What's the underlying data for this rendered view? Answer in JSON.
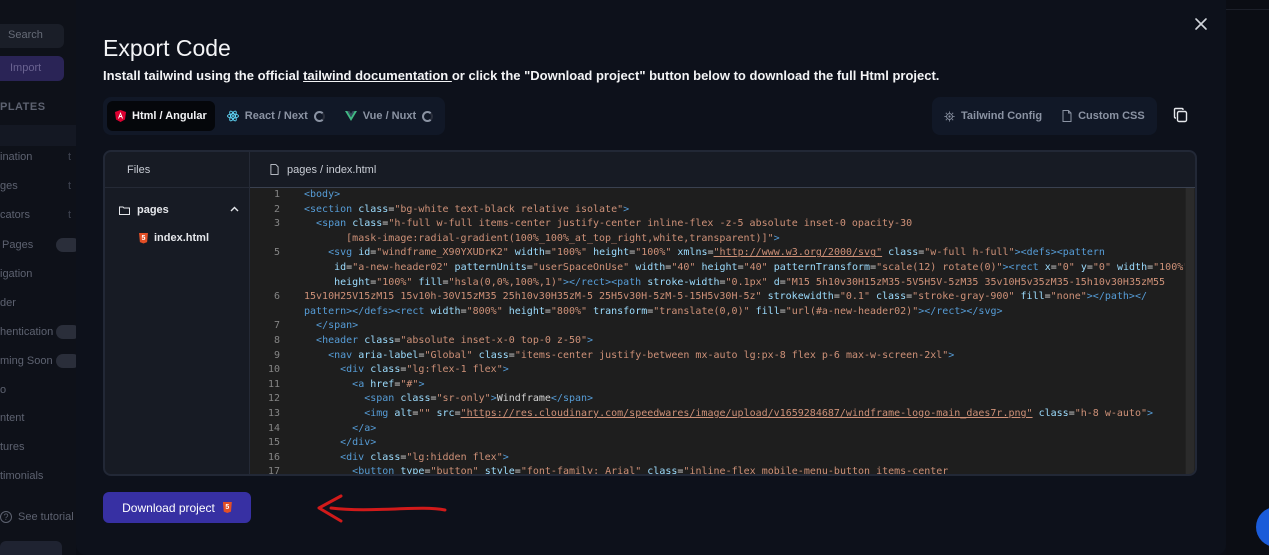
{
  "background": {
    "search_label": "Search",
    "import_label": "Import",
    "section_heading": "PLATES",
    "items": [
      {
        "label": "ination",
        "sub": "t"
      },
      {
        "label": "ges",
        "sub": "t"
      },
      {
        "label": "cators",
        "sub": "t"
      },
      {
        "label": "Pages",
        "badge": true
      },
      {
        "label": "igation"
      },
      {
        "label": "der"
      },
      {
        "label": "hentication",
        "badge": true
      },
      {
        "label": "ming Soon",
        "badge": true
      },
      {
        "label": "o"
      },
      {
        "label": "ntent"
      },
      {
        "label": "tures"
      },
      {
        "label": "timonials"
      }
    ],
    "tutorial_label": "See tutorial"
  },
  "modal": {
    "title": "Export Code",
    "subtitle_before": "Install tailwind using the official ",
    "subtitle_link": "tailwind documentation ",
    "subtitle_after": "or click the \"Download project\" button below to download the full Html project.",
    "frameworks": [
      {
        "label": "Html / Angular",
        "icon": "angular-icon",
        "active": true
      },
      {
        "label": "React / Next",
        "icon": "react-icon",
        "active": false
      },
      {
        "label": "Vue / Nuxt",
        "icon": "vue-icon",
        "active": false
      }
    ],
    "config_buttons": [
      {
        "label": "Tailwind Config",
        "icon": "gear-icon"
      },
      {
        "label": "Custom CSS",
        "icon": "file-icon"
      }
    ],
    "files_header": "Files",
    "folder_name": "pages",
    "file_name": "index.html",
    "code_tab": "pages / index.html",
    "download_label": "Download project",
    "colors": {
      "accent": "#3730a3",
      "arrow": "#d11a1a",
      "html5": "#e34f26"
    }
  }
}
